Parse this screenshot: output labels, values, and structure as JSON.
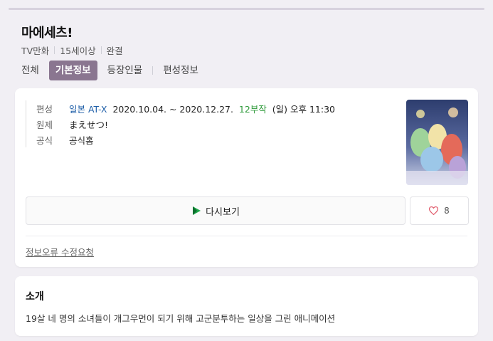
{
  "header": {
    "title": "마에세츠!",
    "meta": [
      "TV만화",
      "15세이상",
      "완결"
    ]
  },
  "tabs": [
    {
      "label": "전체",
      "active": false
    },
    {
      "label": "기본정보",
      "active": true
    },
    {
      "label": "등장인물",
      "active": false
    },
    {
      "label": "편성정보",
      "active": false
    }
  ],
  "info": {
    "broadcast_label": "편성",
    "broadcast_channel": "일본 AT-X",
    "broadcast_dates": "2020.10.04. ~ 2020.12.27.",
    "broadcast_episodes": "12부작",
    "broadcast_time": "(일) 오후 11:30",
    "original_label": "원제",
    "original_value": "まえせつ!",
    "official_label": "공식",
    "official_value": "공식홈"
  },
  "actions": {
    "replay_label": "다시보기",
    "like_count": "8"
  },
  "report_label": "정보오류 수정요청",
  "intro": {
    "title": "소개",
    "text": "19살 네 명의 소녀들이 개그우먼이 되기 위해 고군분투하는 일상을 그린 애니메이션"
  },
  "colors": {
    "active_tab": "#8a7690",
    "link": "#1f5fa8",
    "episodes": "#2e9a3a",
    "background": "#f1eff4",
    "like_heart": "#e05a6a"
  }
}
